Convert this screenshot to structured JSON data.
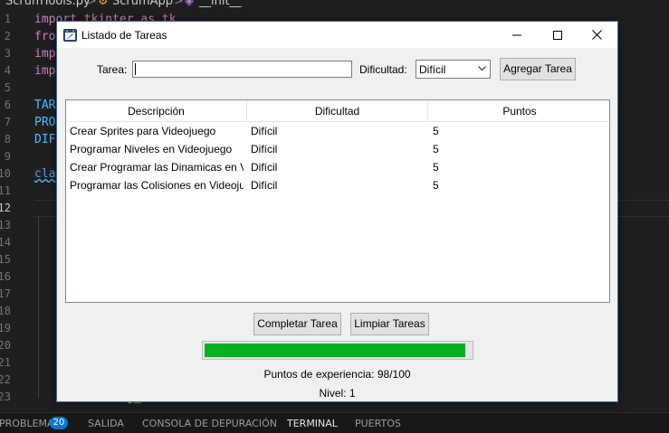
{
  "editor": {
    "breadcrumb": {
      "file": "ScrumTools.py",
      "cls": "ScrumApp",
      "method": "__init__",
      "sep": ">"
    },
    "line_numbers": [
      "1",
      "2",
      "3",
      "4",
      "5",
      "6",
      "7",
      "8",
      "9",
      "10",
      "11",
      "12",
      "13",
      "14",
      "15",
      "16",
      "17",
      "18",
      "19",
      "20",
      "21",
      "22",
      "23"
    ],
    "active_line": "12",
    "code": {
      "l1": "import tkinter as tk",
      "l2": "fro",
      "l3": "imp",
      "l4": "imp",
      "l6": "TAR",
      "l7": "PRO",
      "l8": "DIF",
      "l10": "cla",
      "l23": "g_       (,"
    }
  },
  "panel": {
    "tabs": [
      "PROBLEMAS",
      "SALIDA",
      "CONSOLA DE DEPURACIÓN",
      "TERMINAL",
      "PUERTOS"
    ],
    "problems_count": "20",
    "active_tab": "TERMINAL"
  },
  "window": {
    "title": "Listado de Tareas",
    "app_icon": "feather-icon",
    "controls": [
      "minimize-icon",
      "maximize-icon",
      "close-icon"
    ]
  },
  "form": {
    "task_label": "Tarea:",
    "task_value": "",
    "difficulty_label": "Dificultad:",
    "difficulty_value": "Difícil",
    "add_button": "Agregar Tarea"
  },
  "table": {
    "columns": [
      "Descripción",
      "Dificultad",
      "Puntos"
    ],
    "rows": [
      [
        "Crear Sprites para Videojuego",
        "Difícil",
        "5"
      ],
      [
        "Programar Niveles en Videojuego",
        "Difícil",
        "5"
      ],
      [
        "Crear Programar las Dinamicas en Videojuego",
        "Difícil",
        "5"
      ],
      [
        "Programar las Colisiones en Videojuego",
        "Difícil",
        "5"
      ]
    ]
  },
  "actions": {
    "complete_button": "Completar Tarea",
    "clear_button": "Limpiar Tareas"
  },
  "progress": {
    "value": 98,
    "max": 100,
    "fill_color": "#06b025"
  },
  "stats": {
    "xp_text": "Puntos de experiencia: 98/100",
    "level_text": "Nivel: 1"
  }
}
